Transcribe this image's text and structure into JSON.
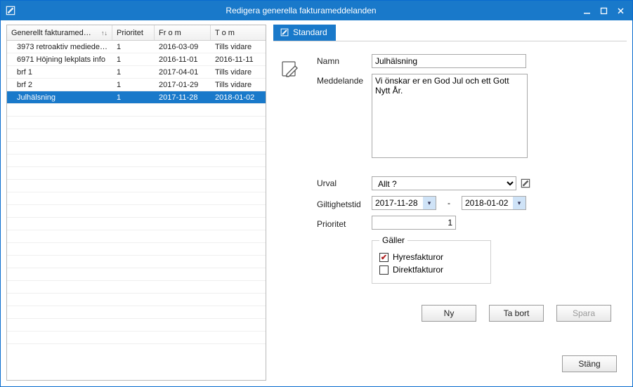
{
  "window": {
    "title": "Redigera generella fakturameddelanden"
  },
  "table": {
    "headers": {
      "name": "Generellt fakturamed…",
      "priority": "Prioritet",
      "from": "Fr o m",
      "to": "T o m"
    },
    "rows": [
      {
        "name": "3973 retroaktiv mediede…",
        "priority": "1",
        "from": "2016-03-09",
        "to": "Tills vidare",
        "selected": false
      },
      {
        "name": "6971 Höjning lekplats info",
        "priority": "1",
        "from": "2016-11-01",
        "to": "2016-11-11",
        "selected": false
      },
      {
        "name": "brf 1",
        "priority": "1",
        "from": "2017-04-01",
        "to": "Tills vidare",
        "selected": false
      },
      {
        "name": "brf 2",
        "priority": "1",
        "from": "2017-01-29",
        "to": "Tills vidare",
        "selected": false
      },
      {
        "name": "Julhälsning",
        "priority": "1",
        "from": "2017-11-28",
        "to": "2018-01-02",
        "selected": true
      }
    ]
  },
  "tab": {
    "label": "Standard"
  },
  "form": {
    "labels": {
      "namn": "Namn",
      "meddelande": "Meddelande",
      "urval": "Urval",
      "giltighetstid": "Giltighetstid",
      "prioritet": "Prioritet",
      "galler": "Gäller",
      "hyresfakturor": "Hyresfakturor",
      "direktfakturor": "Direktfakturor"
    },
    "values": {
      "namn": "Julhälsning",
      "meddelande": "Vi önskar er en God Jul och ett Gott Nytt År.",
      "urval": "Allt ?",
      "fromDate": "2017-11-28",
      "toDate": "2018-01-02",
      "prioritet": "1",
      "hyresfakturor_checked": true,
      "direktfakturor_checked": false
    }
  },
  "buttons": {
    "ny": "Ny",
    "tabort": "Ta bort",
    "spara": "Spara",
    "stang": "Stäng"
  }
}
